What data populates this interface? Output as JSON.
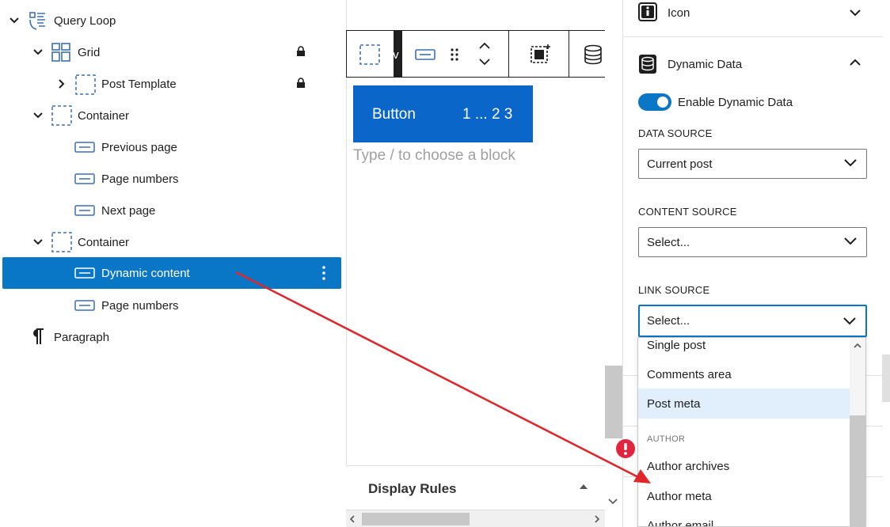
{
  "list_view": {
    "items": [
      {
        "label": "Query Loop",
        "icon": "query-loop-icon",
        "depth": 0,
        "expand": "down"
      },
      {
        "label": "Grid",
        "icon": "grid-icon",
        "depth": 1,
        "expand": "down",
        "locked": true
      },
      {
        "label": "Post Template",
        "icon": "post-template-icon",
        "depth": 2,
        "expand": "right",
        "locked": true
      },
      {
        "label": "Container",
        "icon": "container-icon",
        "depth": 1,
        "expand": "down"
      },
      {
        "label": "Previous page",
        "icon": "button-icon",
        "depth": 2
      },
      {
        "label": "Page numbers",
        "icon": "button-icon",
        "depth": 2
      },
      {
        "label": "Next page",
        "icon": "button-icon",
        "depth": 2
      },
      {
        "label": "Container",
        "icon": "container-icon",
        "depth": 1,
        "expand": "down"
      },
      {
        "label": "Dynamic content",
        "icon": "button-icon",
        "depth": 2,
        "selected": true
      },
      {
        "label": "Page numbers",
        "icon": "button-icon",
        "depth": 2
      },
      {
        "label": "Paragraph",
        "icon": "paragraph-icon",
        "depth": 0
      }
    ]
  },
  "canvas": {
    "toolbar_partial_text": "ev",
    "button_block": {
      "label": "Button",
      "pagination": "1 ... 2 3"
    },
    "block_hint": "Type / to choose a block",
    "display_rules_label": "Display Rules"
  },
  "inspector": {
    "icon_panel_title": "Icon",
    "dynamic_panel_title": "Dynamic Data",
    "toggle_label": "Enable Dynamic Data",
    "toggle_on": true,
    "data_source": {
      "label": "DATA SOURCE",
      "value": "Current post"
    },
    "content_source": {
      "label": "CONTENT SOURCE",
      "value": "Select..."
    },
    "link_source": {
      "label": "LINK SOURCE",
      "value": "Select..."
    },
    "dropdown": {
      "options": [
        "Single post",
        "Comments area",
        "Post meta"
      ],
      "highlighted": "Post meta",
      "group_label": "AUTHOR",
      "group_options": [
        "Author archives",
        "Author meta",
        "Author email"
      ]
    }
  },
  "colors": {
    "accent": "#0a76c6",
    "button_block": "#0a66c8",
    "annotation_arrow": "#e0262b",
    "warning_badge": "#e0263f"
  }
}
